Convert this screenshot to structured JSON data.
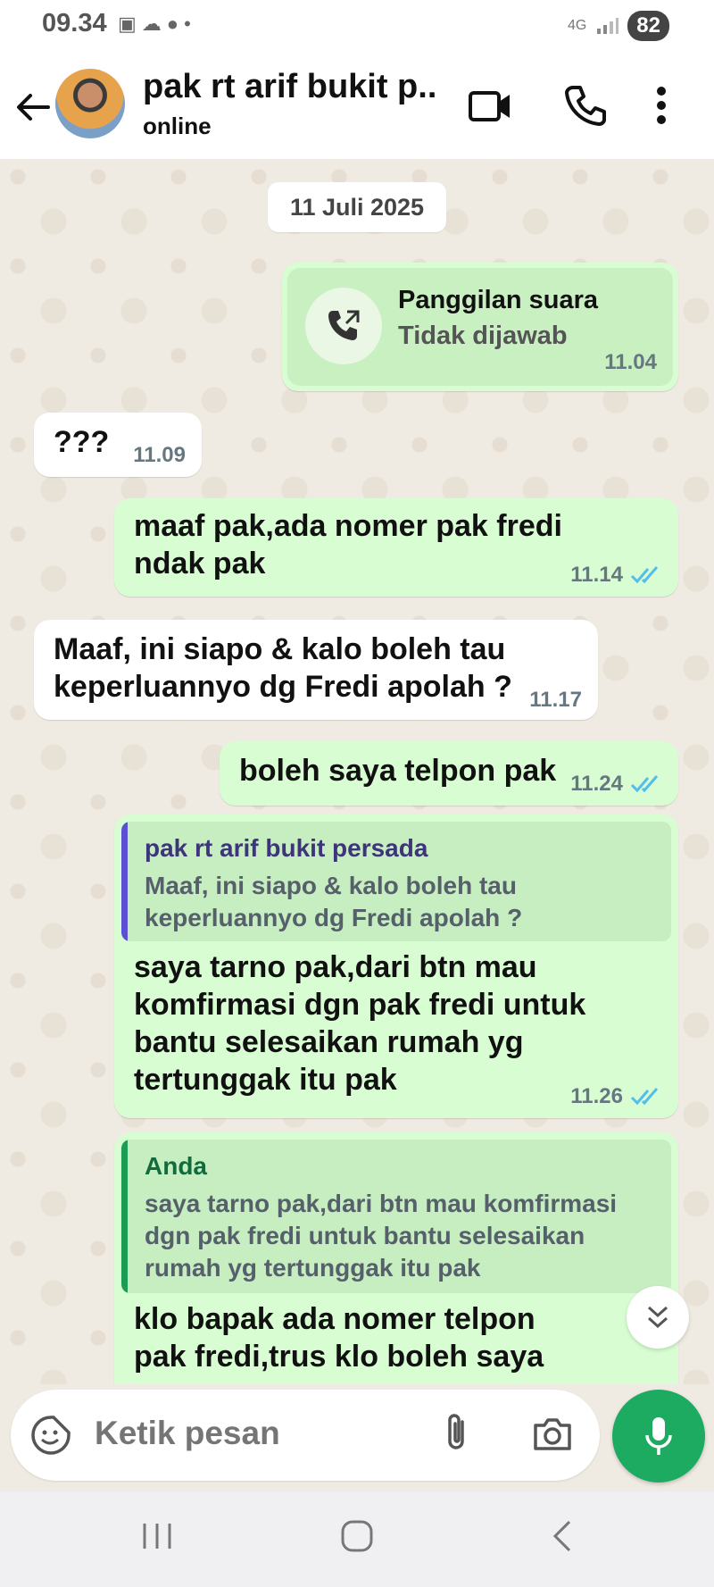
{
  "status_bar": {
    "time": "09.34",
    "network": "4G",
    "battery": "82"
  },
  "header": {
    "contact_name": "pak rt arif bukit p...",
    "contact_status": "online"
  },
  "chat": {
    "date": "11 Juli 2025",
    "messages": [
      {
        "type": "call",
        "direction": "out",
        "title": "Panggilan suara",
        "subtitle": "Tidak dijawab",
        "time": "11.04"
      },
      {
        "direction": "in",
        "text": "???",
        "time": "11.09"
      },
      {
        "direction": "out",
        "text": "maaf pak,ada nomer pak fredi ndak pak",
        "time": "11.14",
        "status": "read"
      },
      {
        "direction": "in",
        "text": "Maaf, ini siapo & kalo boleh tau keperluannyo dg Fredi apolah ?",
        "time": "11.17"
      },
      {
        "direction": "out",
        "text": "boleh saya telpon pak",
        "time": "11.24",
        "status": "read"
      },
      {
        "direction": "out",
        "quote": {
          "author": "pak rt arif bukit persada",
          "text": "Maaf, ini siapo & kalo boleh tau keperluannyo dg Fredi apolah ?"
        },
        "text": "saya tarno pak,dari btn mau komfirmasi dgn pak fredi untuk bantu selesaikan rumah yg tertunggak itu pak",
        "time": "11.26",
        "status": "read"
      },
      {
        "direction": "out",
        "quote": {
          "author": "Anda",
          "text": "saya tarno pak,dari btn mau komfirmasi dgn pak fredi untuk bantu selesaikan rumah yg tertunggak itu pak"
        },
        "text": "klo bapak ada nomer telpon pak fredi,trus klo boleh saya"
      }
    ]
  },
  "composer": {
    "placeholder": "Ketik pesan"
  },
  "colors": {
    "outgoing_bubble": "#d9fdd3",
    "incoming_bubble": "#ffffff",
    "read_ticks": "#53bdeb",
    "mic_button": "#1daa61",
    "quote_bar_contact": "#5b4fd6",
    "quote_bar_self": "#1a9c55"
  },
  "icons": [
    "back-arrow-icon",
    "video-call-icon",
    "voice-call-icon",
    "more-vert-icon",
    "missed-call-icon",
    "double-check-icon",
    "scroll-down-icon",
    "sticker-icon",
    "attach-icon",
    "camera-icon",
    "mic-icon",
    "recents-icon",
    "home-icon",
    "back-nav-icon"
  ]
}
